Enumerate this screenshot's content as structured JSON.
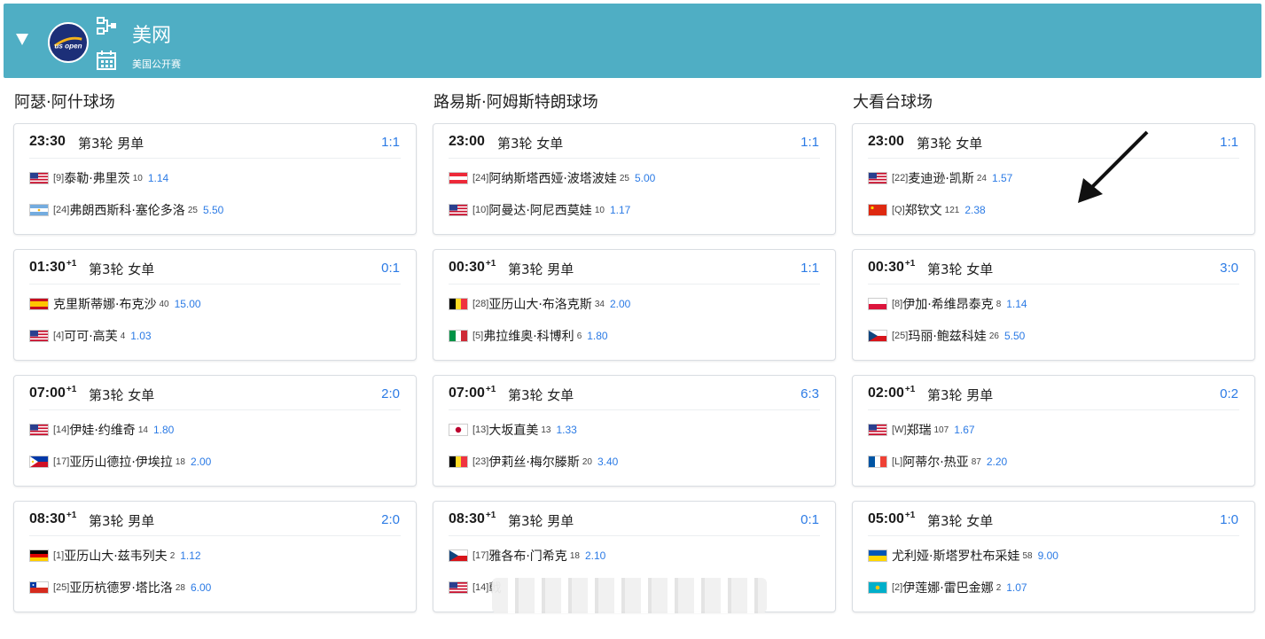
{
  "header": {
    "title": "美网",
    "subtitle": "美国公开赛",
    "logo_text": "us open",
    "icons": [
      "collapse-triangle-icon",
      "bracket-icon",
      "calendar-icon"
    ]
  },
  "courts": [
    {
      "name": "阿瑟·阿什球场",
      "matches": [
        {
          "time": "23:30",
          "day_offset": "",
          "round": "第3轮 男单",
          "score": "1:1",
          "p1": {
            "flag": "us",
            "seed": "[9]",
            "name": "泰勒·弗里茨",
            "rank": "10",
            "odds": "1.14"
          },
          "p2": {
            "flag": "ar",
            "seed": "[24]",
            "name": "弗朗西斯科·塞伦多洛",
            "rank": "25",
            "odds": "5.50"
          }
        },
        {
          "time": "01:30",
          "day_offset": "+1",
          "round": "第3轮 女单",
          "score": "0:1",
          "p1": {
            "flag": "es",
            "seed": "",
            "name": "克里斯蒂娜·布克沙",
            "rank": "40",
            "odds": "15.00"
          },
          "p2": {
            "flag": "us",
            "seed": "[4]",
            "name": "可可·高芙",
            "rank": "4",
            "odds": "1.03"
          }
        },
        {
          "time": "07:00",
          "day_offset": "+1",
          "round": "第3轮 女单",
          "score": "2:0",
          "p1": {
            "flag": "us",
            "seed": "[14]",
            "name": "伊娃·约维奇",
            "rank": "14",
            "odds": "1.80"
          },
          "p2": {
            "flag": "ph",
            "seed": "[17]",
            "name": "亚历山德拉·伊埃拉",
            "rank": "18",
            "odds": "2.00"
          }
        },
        {
          "time": "08:30",
          "day_offset": "+1",
          "round": "第3轮 男单",
          "score": "2:0",
          "p1": {
            "flag": "de",
            "seed": "[1]",
            "name": "亚历山大·兹韦列夫",
            "rank": "2",
            "odds": "1.12"
          },
          "p2": {
            "flag": "cl",
            "seed": "[25]",
            "name": "亚历杭德罗·塔比洛",
            "rank": "28",
            "odds": "6.00"
          }
        }
      ]
    },
    {
      "name": "路易斯·阿姆斯特朗球场",
      "matches": [
        {
          "time": "23:00",
          "day_offset": "",
          "round": "第3轮 女单",
          "score": "1:1",
          "p1": {
            "flag": "at",
            "seed": "[24]",
            "name": "阿纳斯塔西娅·波塔波娃",
            "rank": "25",
            "odds": "5.00"
          },
          "p2": {
            "flag": "us",
            "seed": "[10]",
            "name": "阿曼达·阿尼西莫娃",
            "rank": "10",
            "odds": "1.17"
          }
        },
        {
          "time": "00:30",
          "day_offset": "+1",
          "round": "第3轮 男单",
          "score": "1:1",
          "p1": {
            "flag": "be",
            "seed": "[28]",
            "name": "亚历山大·布洛克斯",
            "rank": "34",
            "odds": "2.00"
          },
          "p2": {
            "flag": "it",
            "seed": "[5]",
            "name": "弗拉维奥·科博利",
            "rank": "6",
            "odds": "1.80"
          }
        },
        {
          "time": "07:00",
          "day_offset": "+1",
          "round": "第3轮 女单",
          "score": "6:3",
          "p1": {
            "flag": "jp",
            "seed": "[13]",
            "name": "大坂直美",
            "rank": "13",
            "odds": "1.33"
          },
          "p2": {
            "flag": "be",
            "seed": "[23]",
            "name": "伊莉丝·梅尔滕斯",
            "rank": "20",
            "odds": "3.40"
          }
        },
        {
          "time": "08:30",
          "day_offset": "+1",
          "round": "第3轮 男单",
          "score": "0:1",
          "p1": {
            "flag": "cz",
            "seed": "[17]",
            "name": "雅各布·门希克",
            "rank": "18",
            "odds": "2.10"
          },
          "p2": {
            "flag": "us",
            "seed": "[14]",
            "name": "戟",
            "rank": "",
            "odds": ""
          }
        }
      ]
    },
    {
      "name": "大看台球场",
      "matches": [
        {
          "time": "23:00",
          "day_offset": "",
          "round": "第3轮 女单",
          "score": "1:1",
          "p1": {
            "flag": "us",
            "seed": "[22]",
            "name": "麦迪逊·凯斯",
            "rank": "24",
            "odds": "1.57"
          },
          "p2": {
            "flag": "cn",
            "seed": "[Q]",
            "name": "郑钦文",
            "rank": "121",
            "odds": "2.38"
          }
        },
        {
          "time": "00:30",
          "day_offset": "+1",
          "round": "第3轮 女单",
          "score": "3:0",
          "p1": {
            "flag": "pl",
            "seed": "[8]",
            "name": "伊加·希维昂泰克",
            "rank": "8",
            "odds": "1.14"
          },
          "p2": {
            "flag": "cz",
            "seed": "[25]",
            "name": "玛丽·鲍兹科娃",
            "rank": "26",
            "odds": "5.50"
          }
        },
        {
          "time": "02:00",
          "day_offset": "+1",
          "round": "第3轮 男单",
          "score": "0:2",
          "p1": {
            "flag": "us",
            "seed": "[W]",
            "name": "郑瑞",
            "rank": "107",
            "odds": "1.67"
          },
          "p2": {
            "flag": "fr",
            "seed": "[L]",
            "name": "阿蒂尔·热亚",
            "rank": "87",
            "odds": "2.20"
          }
        },
        {
          "time": "05:00",
          "day_offset": "+1",
          "round": "第3轮 女单",
          "score": "1:0",
          "p1": {
            "flag": "ua",
            "seed": "",
            "name": "尤利娅·斯塔罗杜布采娃",
            "rank": "58",
            "odds": "9.00"
          },
          "p2": {
            "flag": "kz",
            "seed": "[2]",
            "name": "伊莲娜·雷巴金娜",
            "rank": "2",
            "odds": "1.07"
          }
        }
      ]
    }
  ],
  "colors": {
    "header_bg": "#4faec4",
    "score": "#2c7be5",
    "odds": "#2c7be5"
  }
}
